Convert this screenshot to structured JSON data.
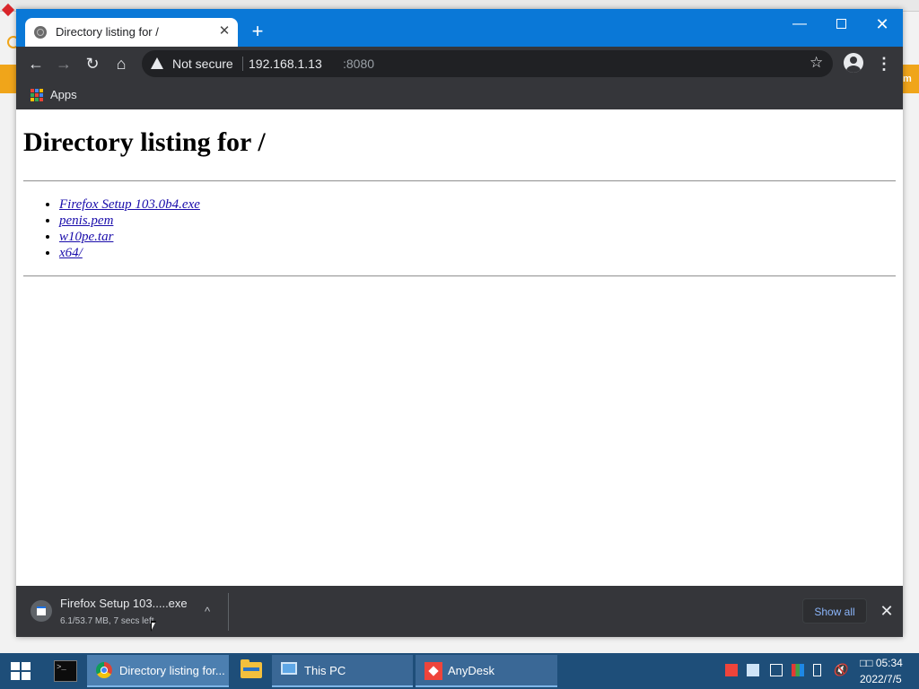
{
  "browser": {
    "tab_title": "Directory listing for /",
    "tab_close_glyph": "✕",
    "new_tab_glyph": "+",
    "window_controls": {
      "minimize": "—",
      "maximize": "",
      "close": "✕"
    },
    "nav": {
      "back": "←",
      "forward": "→",
      "reload": "↻",
      "home": "⌂"
    },
    "security_label": "Not secure",
    "url_host": "192.168.1.13",
    "url_port": ":8080",
    "star_glyph": "☆",
    "menu_glyph": "⋮",
    "bookmarks": {
      "apps_label": "Apps"
    }
  },
  "page": {
    "heading": "Directory listing for /",
    "files": [
      {
        "name": "Firefox Setup 103.0b4.exe"
      },
      {
        "name": "penis.pem"
      },
      {
        "name": "w10pe.tar"
      },
      {
        "name": "x64/"
      }
    ]
  },
  "download_shelf": {
    "file_name": "Firefox Setup 103.....exe",
    "status": "6.1/53.7 MB, 7 secs left",
    "chevron_glyph": "^",
    "show_all_label": "Show all",
    "close_glyph": "✕"
  },
  "taskbar": {
    "items": [
      {
        "label": "Directory listing for..."
      },
      {
        "label": "This PC"
      },
      {
        "label": "AnyDesk"
      }
    ],
    "terminal_glyph": ">_",
    "volume_glyph": "🔇",
    "clock": {
      "time": "□□ 05:34",
      "date": "2022/7/5"
    }
  },
  "background_window": {
    "right_edge_text": "m"
  },
  "colors": {
    "titlebar": "#0a78d7",
    "toolbar": "#35363a",
    "link": "#1a0dab",
    "taskbar": "#1e4e79",
    "accent_orange": "#f0a51a"
  }
}
